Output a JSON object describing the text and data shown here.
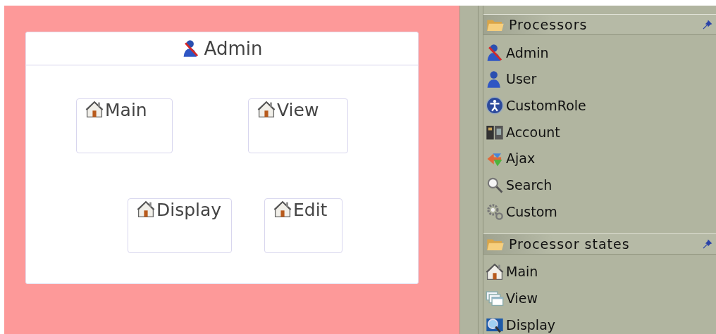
{
  "diagram": {
    "title": "Admin",
    "states": [
      {
        "label": "Main"
      },
      {
        "label": "View"
      },
      {
        "label": "Display"
      },
      {
        "label": "Edit"
      }
    ]
  },
  "palette": {
    "groups": [
      {
        "title": "Processors",
        "items": [
          {
            "label": "Admin",
            "kind": "admin"
          },
          {
            "label": "User",
            "kind": "user"
          },
          {
            "label": "CustomRole",
            "kind": "role"
          },
          {
            "label": "Account",
            "kind": "account"
          },
          {
            "label": "Ajax",
            "kind": "ajax"
          },
          {
            "label": "Search",
            "kind": "search"
          },
          {
            "label": "Custom",
            "kind": "custom"
          }
        ]
      },
      {
        "title": "Processor states",
        "items": [
          {
            "label": "Main",
            "kind": "home"
          },
          {
            "label": "View",
            "kind": "view"
          },
          {
            "label": "Display",
            "kind": "display"
          }
        ]
      }
    ]
  }
}
